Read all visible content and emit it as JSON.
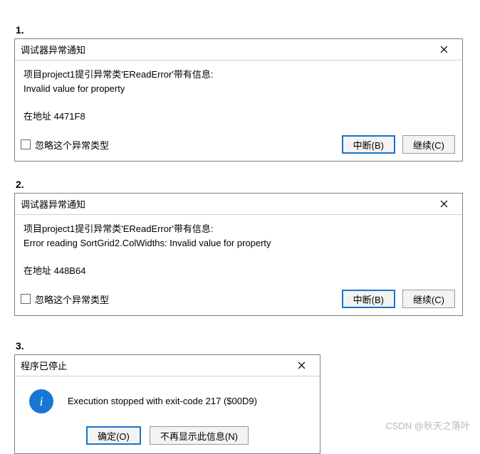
{
  "sections": {
    "s1": {
      "label": "1."
    },
    "s2": {
      "label": "2."
    },
    "s3": {
      "label": "3."
    }
  },
  "dialog1": {
    "title": "调试器异常通知",
    "line1": "项目project1提引异常类'EReadError'带有信息:",
    "line2": "Invalid value for property",
    "addr": "在地址 4471F8",
    "ignore": "忽略这个异常类型",
    "break": "中断(B)",
    "continue": "继续(C)"
  },
  "dialog2": {
    "title": "调试器异常通知",
    "line1": "项目project1提引异常类'EReadError'带有信息:",
    "line2": "Error reading SortGrid2.ColWidths: Invalid value for property",
    "addr": "在地址 448B64",
    "ignore": "忽略这个异常类型",
    "break": "中断(B)",
    "continue": "继续(C)"
  },
  "dialog3": {
    "title": "程序已停止",
    "message": "Execution stopped with exit-code 217 ($00D9)",
    "ok": "确定(O)",
    "noshow": "不再显示此信息(N)"
  },
  "watermark": "CSDN @秋天之落叶"
}
